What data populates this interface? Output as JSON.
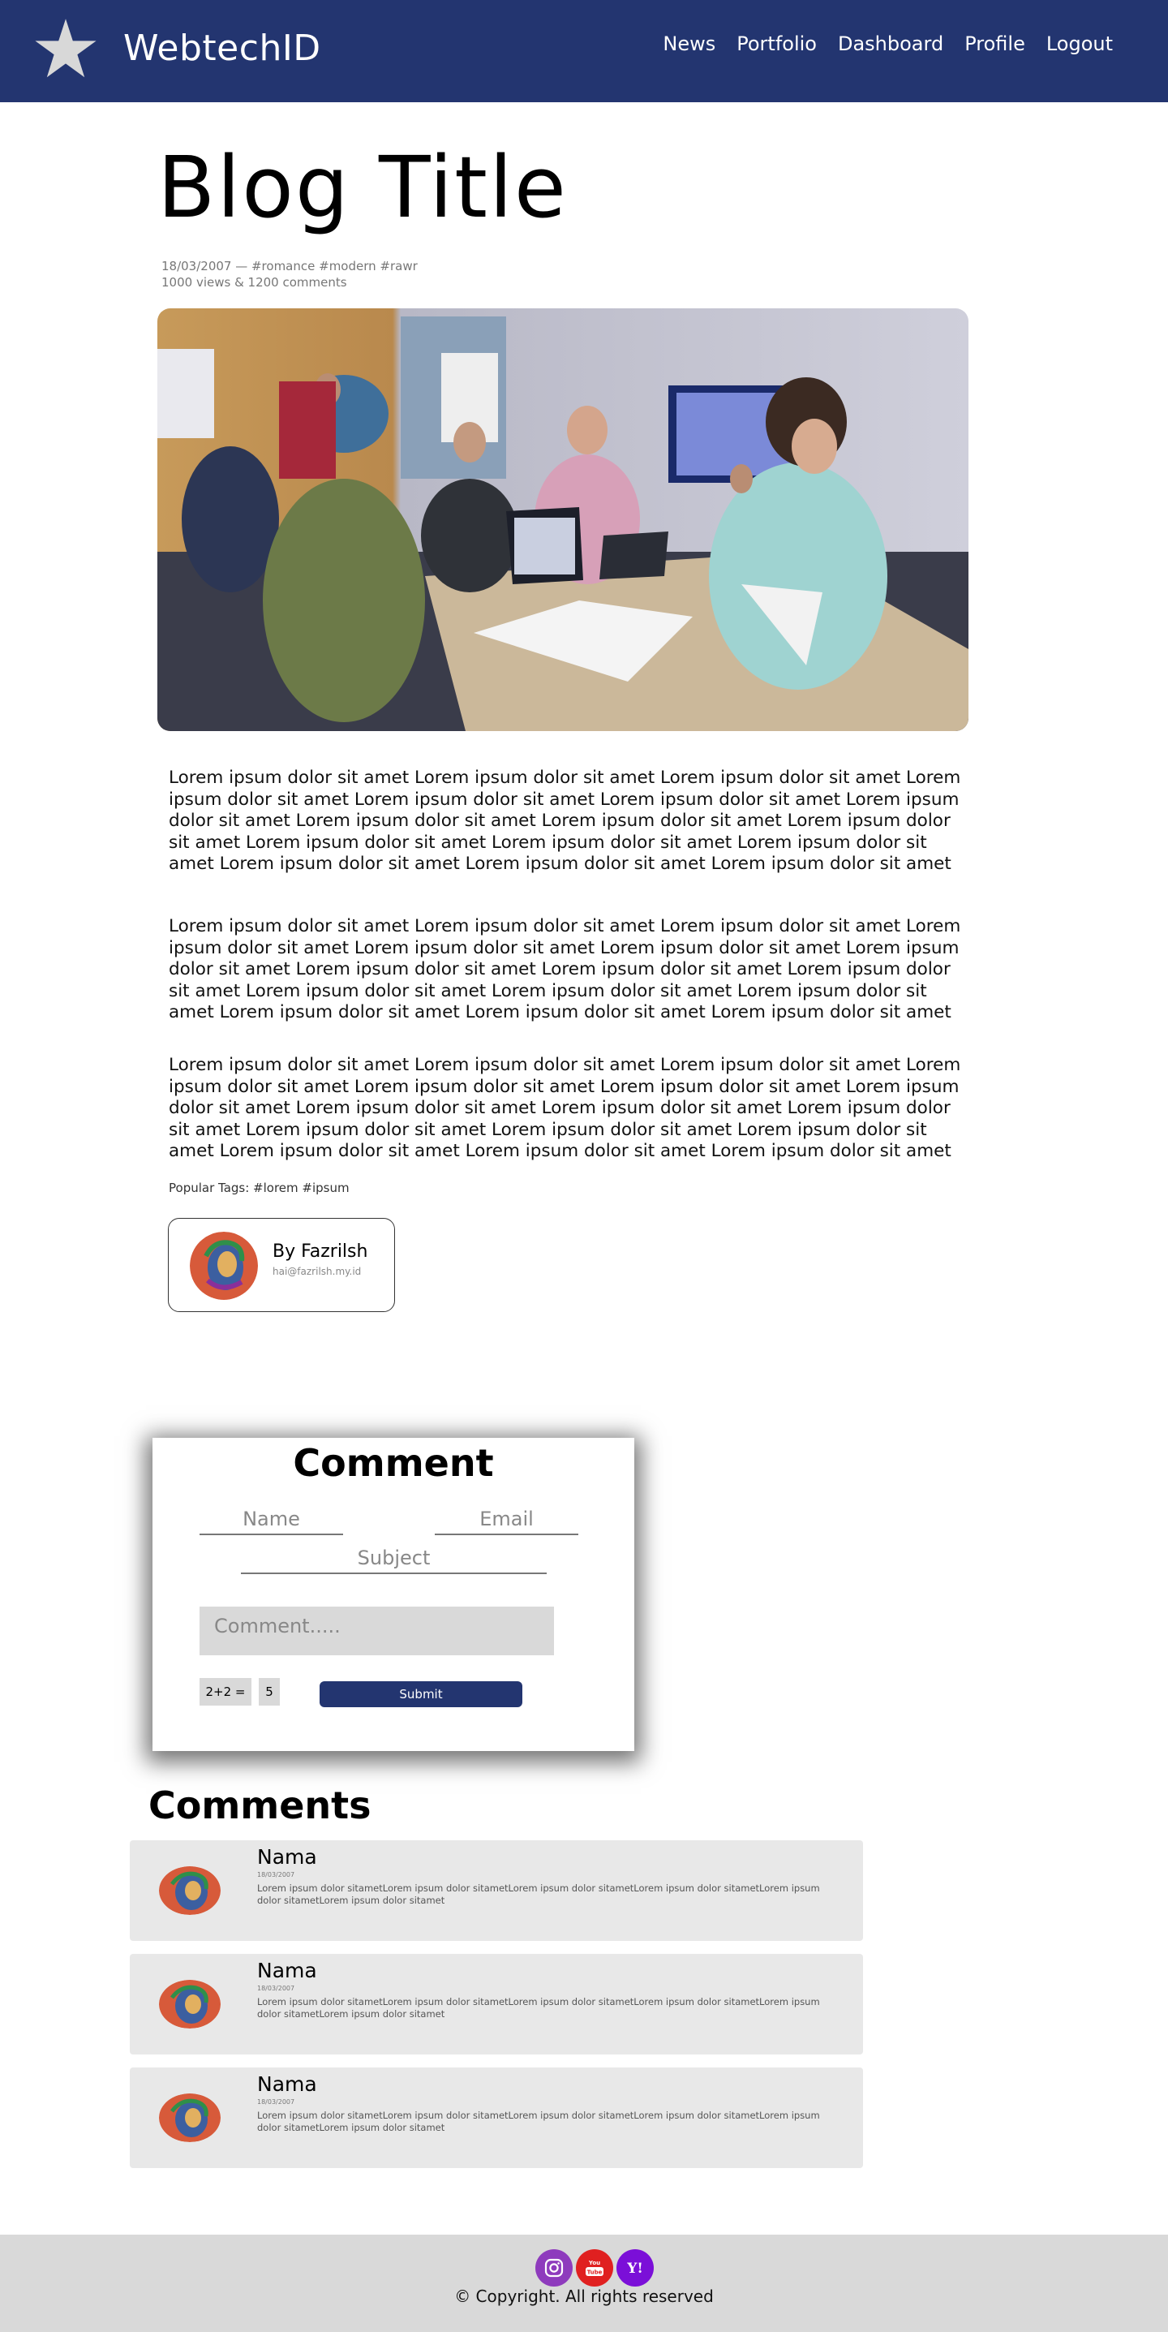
{
  "navbar": {
    "brand": "WebtechID",
    "logo_icon": "star-icon",
    "links": [
      "News",
      "Portfolio",
      "Dashboard",
      "Profile",
      "Logout"
    ]
  },
  "blog": {
    "title": "Blog Title",
    "meta_line1": "18/03/2007 — #romance #modern #rawr",
    "meta_line2": "1000 views & 1200 comments",
    "paragraphs": [
      "Lorem ipsum dolor sit amet Lorem ipsum dolor sit amet Lorem ipsum dolor sit amet Lorem ipsum dolor sit amet Lorem ipsum dolor sit amet Lorem ipsum dolor sit amet Lorem ipsum dolor sit amet Lorem ipsum dolor sit amet Lorem ipsum dolor sit amet Lorem ipsum dolor sit amet Lorem ipsum dolor sit amet Lorem ipsum dolor sit amet Lorem ipsum dolor sit amet Lorem ipsum dolor sit amet Lorem ipsum dolor sit amet Lorem ipsum dolor sit amet",
      "Lorem ipsum dolor sit amet Lorem ipsum dolor sit amet Lorem ipsum dolor sit amet Lorem ipsum dolor sit amet Lorem ipsum dolor sit amet Lorem ipsum dolor sit amet Lorem ipsum dolor sit amet Lorem ipsum dolor sit amet Lorem ipsum dolor sit amet Lorem ipsum dolor sit amet Lorem ipsum dolor sit amet Lorem ipsum dolor sit amet Lorem ipsum dolor sit amet Lorem ipsum dolor sit amet Lorem ipsum dolor sit amet Lorem ipsum dolor sit amet",
      "Lorem ipsum dolor sit amet Lorem ipsum dolor sit amet Lorem ipsum dolor sit amet Lorem ipsum dolor sit amet Lorem ipsum dolor sit amet Lorem ipsum dolor sit amet Lorem ipsum dolor sit amet Lorem ipsum dolor sit amet Lorem ipsum dolor sit amet Lorem ipsum dolor sit amet Lorem ipsum dolor sit amet Lorem ipsum dolor sit amet Lorem ipsum dolor sit amet Lorem ipsum dolor sit amet Lorem ipsum dolor sit amet Lorem ipsum dolor sit amet"
    ],
    "popular_tags": "Popular Tags: #lorem #ipsum"
  },
  "author": {
    "name": "By Fazrilsh",
    "email": "hai@fazrilsh.my.id"
  },
  "comment_form": {
    "title": "Comment",
    "name_placeholder": "Name",
    "email_placeholder": "Email",
    "subject_placeholder": "Subject",
    "comment_placeholder": "Comment.....",
    "captcha_question": "2+2 =",
    "captcha_answer": "5",
    "submit_label": "Submit"
  },
  "comments": {
    "heading": "Comments",
    "items": [
      {
        "name": "Nama",
        "date": "18/03/2007",
        "text": "Lorem ipsum dolor sitametLorem ipsum dolor sitametLorem ipsum dolor sitametLorem ipsum dolor sitametLorem ipsum dolor sitametLorem ipsum dolor sitamet"
      },
      {
        "name": "Nama",
        "date": "18/03/2007",
        "text": "Lorem ipsum dolor sitametLorem ipsum dolor sitametLorem ipsum dolor sitametLorem ipsum dolor sitametLorem ipsum dolor sitametLorem ipsum dolor sitamet"
      },
      {
        "name": "Nama",
        "date": "18/03/2007",
        "text": "Lorem ipsum dolor sitametLorem ipsum dolor sitametLorem ipsum dolor sitametLorem ipsum dolor sitametLorem ipsum dolor sitametLorem ipsum dolor sitamet"
      }
    ]
  },
  "footer": {
    "copyright": "© Copyright. All rights reserved",
    "social_icons": [
      "instagram-icon",
      "youtube-icon",
      "yahoo-icon"
    ]
  },
  "colors": {
    "navbar_bg": "#233570",
    "footer_bg": "#d9d9d9",
    "comment_bg": "#e8e8e8",
    "instagram": "#8e3bbd",
    "youtube": "#e02020",
    "yahoo": "#7b0fd8"
  }
}
